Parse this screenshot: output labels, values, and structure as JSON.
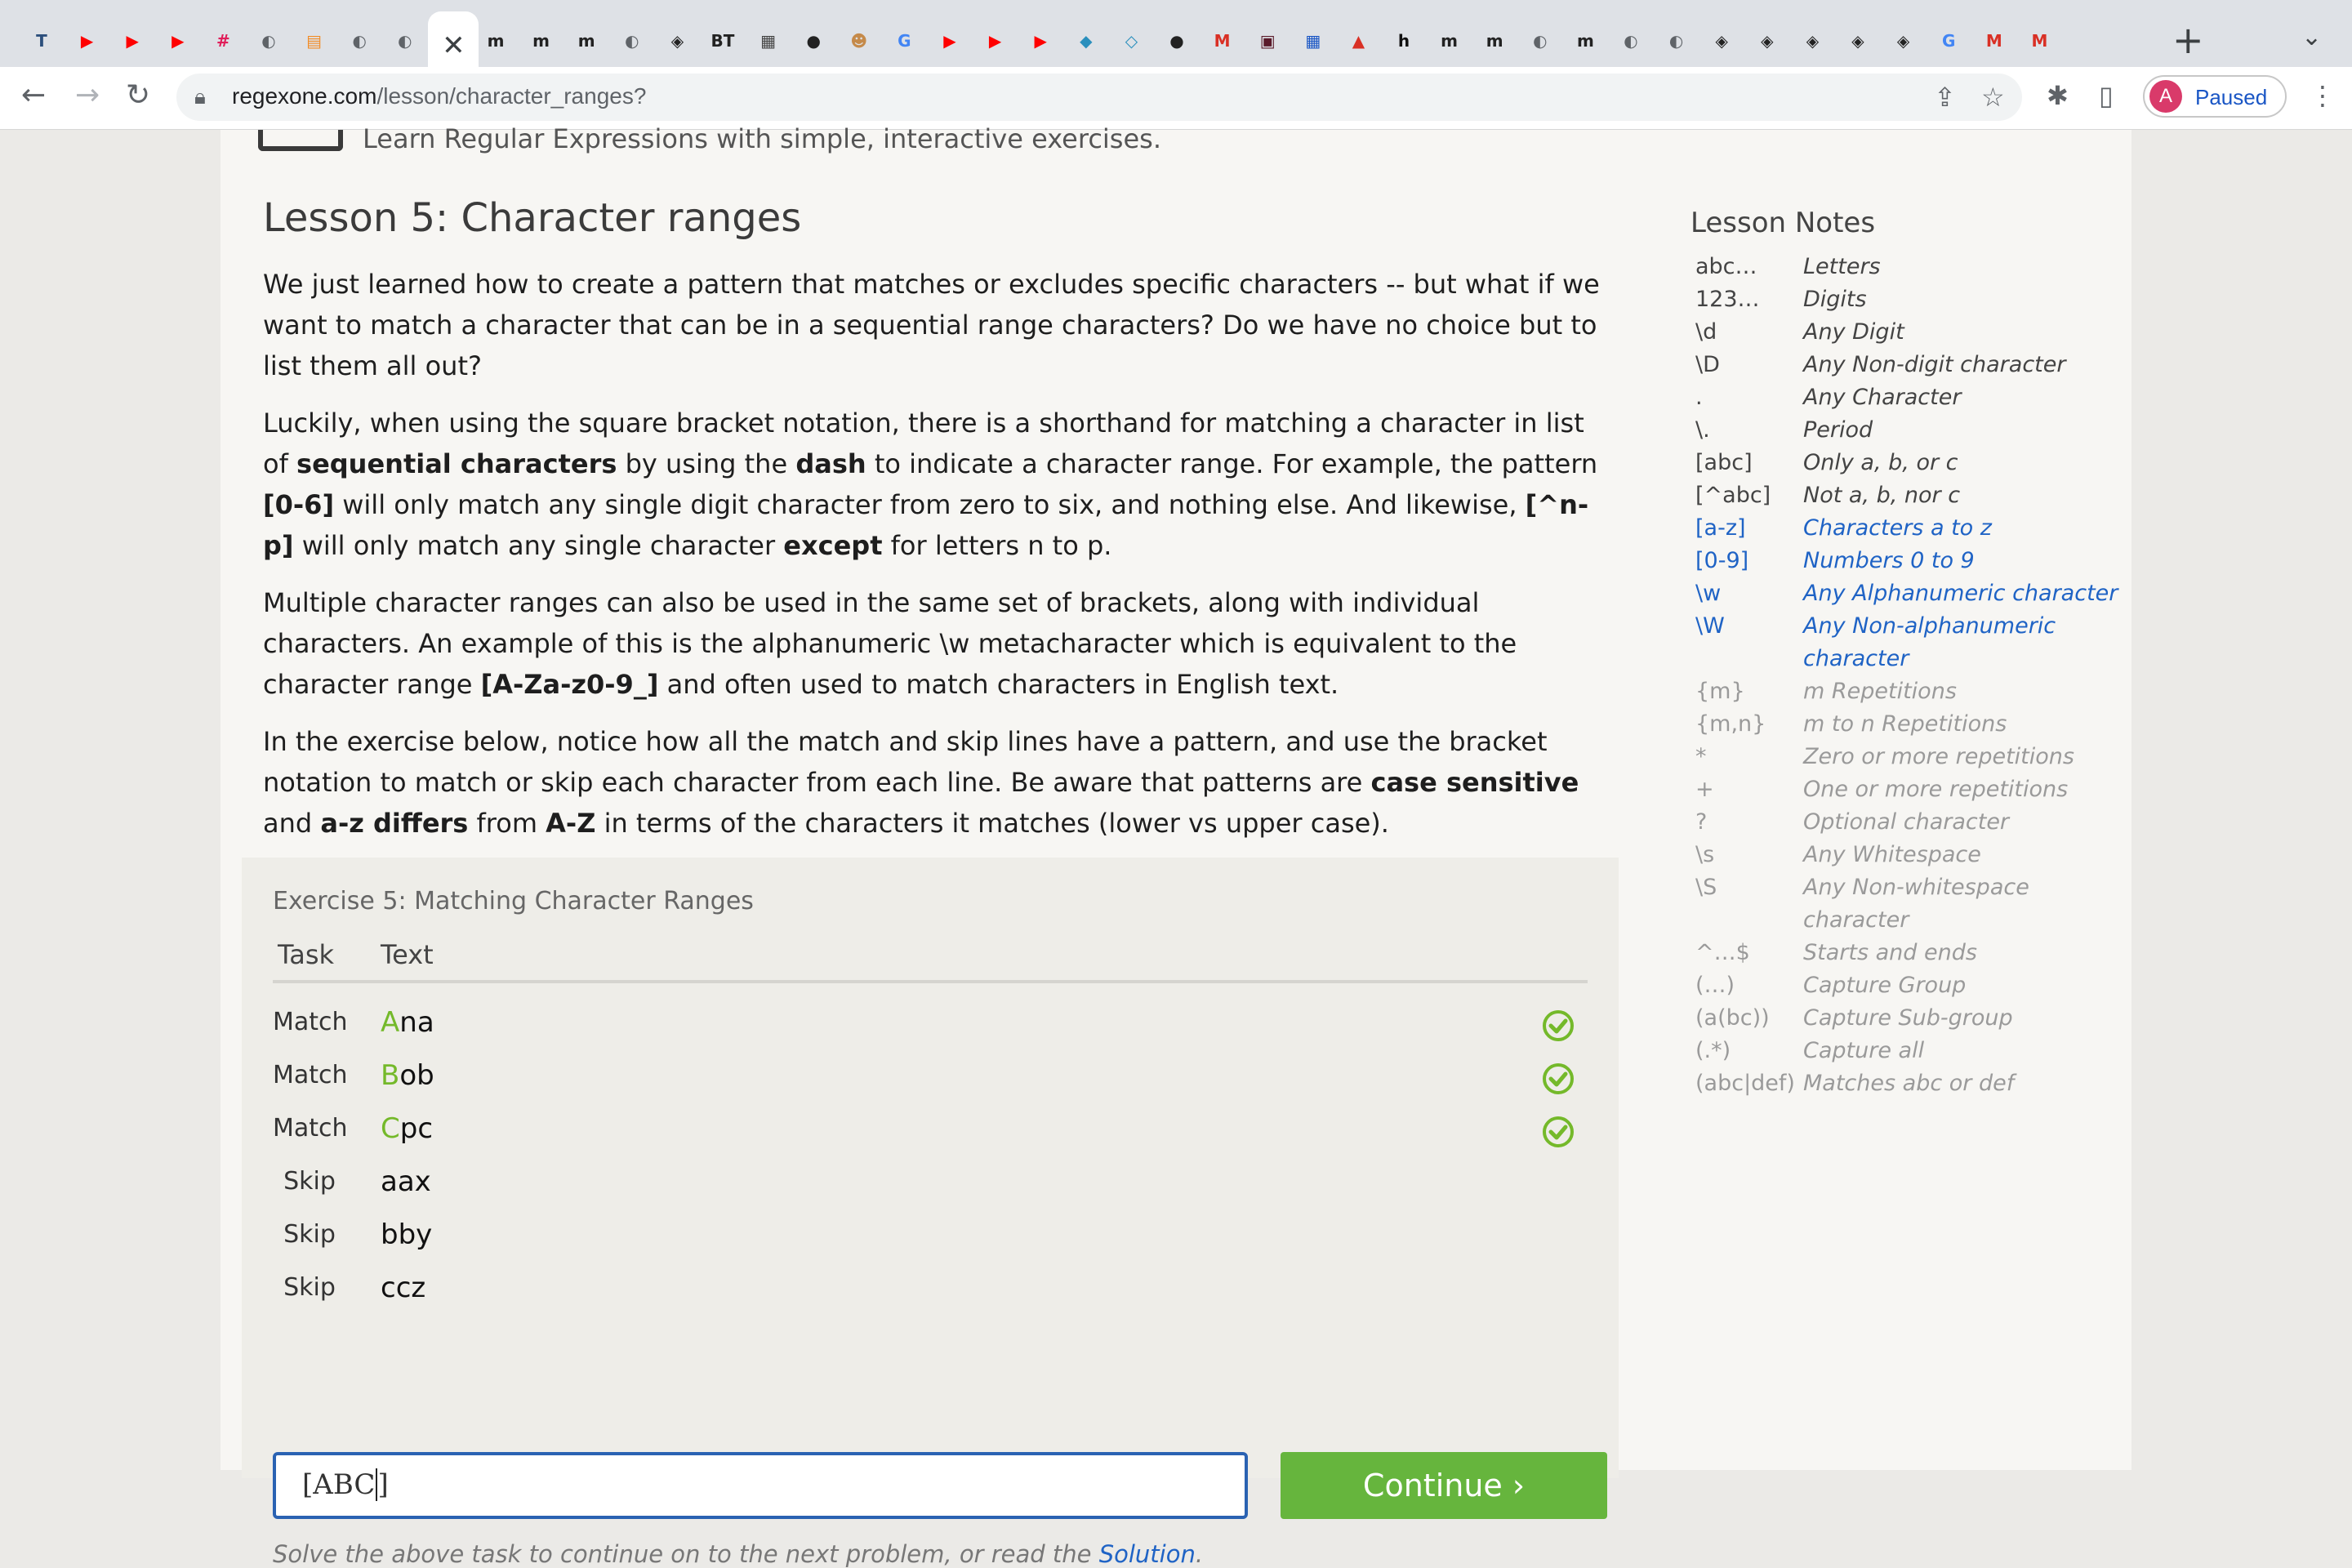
{
  "browser": {
    "tabs": [
      {
        "icon": "tumblr-t",
        "color": "#2c4f7c",
        "glyph": "T"
      },
      {
        "icon": "youtube",
        "color": "#ff0000",
        "glyph": "▶"
      },
      {
        "icon": "youtube",
        "color": "#ff0000",
        "glyph": "▶"
      },
      {
        "icon": "youtube",
        "color": "#ff0000",
        "glyph": "▶"
      },
      {
        "icon": "slack",
        "color": "#e01e5a",
        "glyph": "#"
      },
      {
        "icon": "globe",
        "color": "#5f6368",
        "glyph": "◐"
      },
      {
        "icon": "calendar",
        "color": "#f28b24",
        "glyph": "▤"
      },
      {
        "icon": "globe",
        "color": "#5f6368",
        "glyph": "◐"
      },
      {
        "icon": "globe",
        "color": "#5f6368",
        "glyph": "◐"
      },
      {
        "icon": "active-close",
        "color": "#3c4043",
        "glyph": "✕"
      },
      {
        "icon": "medium",
        "color": "#222",
        "glyph": "m"
      },
      {
        "icon": "medium",
        "color": "#222",
        "glyph": "m"
      },
      {
        "icon": "medium",
        "color": "#222",
        "glyph": "m"
      },
      {
        "icon": "globe",
        "color": "#5f6368",
        "glyph": "◐"
      },
      {
        "icon": "codepen",
        "color": "#222",
        "glyph": "◈"
      },
      {
        "icon": "bt",
        "color": "#222",
        "glyph": "BT"
      },
      {
        "icon": "pug",
        "color": "#444",
        "glyph": "▦"
      },
      {
        "icon": "github",
        "color": "#222",
        "glyph": "●"
      },
      {
        "icon": "person",
        "color": "#c58a4a",
        "glyph": "☻"
      },
      {
        "icon": "google",
        "color": "#4285f4",
        "glyph": "G"
      },
      {
        "icon": "youtube",
        "color": "#ff0000",
        "glyph": "▶"
      },
      {
        "icon": "youtube",
        "color": "#ff0000",
        "glyph": "▶"
      },
      {
        "icon": "youtube",
        "color": "#ff0000",
        "glyph": "▶"
      },
      {
        "icon": "diamond",
        "color": "#2a8fbd",
        "glyph": "◆"
      },
      {
        "icon": "diamond",
        "color": "#2a8fbd",
        "glyph": "◇"
      },
      {
        "icon": "github",
        "color": "#222",
        "glyph": "●"
      },
      {
        "icon": "gmail",
        "color": "#d93025",
        "glyph": "M"
      },
      {
        "icon": "dark-app",
        "color": "#5a1a2a",
        "glyph": "▣"
      },
      {
        "icon": "grid",
        "color": "#1a56c5",
        "glyph": "▦"
      },
      {
        "icon": "pdf",
        "color": "#d93025",
        "glyph": "▲"
      },
      {
        "icon": "h-app",
        "color": "#111",
        "glyph": "h"
      },
      {
        "icon": "medium",
        "color": "#222",
        "glyph": "m"
      },
      {
        "icon": "medium",
        "color": "#222",
        "glyph": "m"
      },
      {
        "icon": "globe",
        "color": "#5f6368",
        "glyph": "◐"
      },
      {
        "icon": "medium",
        "color": "#222",
        "glyph": "m"
      },
      {
        "icon": "globe",
        "color": "#5f6368",
        "glyph": "◐"
      },
      {
        "icon": "globe",
        "color": "#5f6368",
        "glyph": "◐"
      },
      {
        "icon": "codepen",
        "color": "#222",
        "glyph": "◈"
      },
      {
        "icon": "codepen",
        "color": "#222",
        "glyph": "◈"
      },
      {
        "icon": "codepen",
        "color": "#222",
        "glyph": "◈"
      },
      {
        "icon": "codepen",
        "color": "#222",
        "glyph": "◈"
      },
      {
        "icon": "codepen",
        "color": "#222",
        "glyph": "◈"
      },
      {
        "icon": "google",
        "color": "#4285f4",
        "glyph": "G"
      },
      {
        "icon": "gmail",
        "color": "#d93025",
        "glyph": "M"
      },
      {
        "icon": "gmail",
        "color": "#d93025",
        "glyph": "M"
      }
    ],
    "new_tab": "+",
    "tab_menu": "⌄",
    "url_host": "regexone.com",
    "url_path": "/lesson/character_ranges?",
    "profile_initial": "A",
    "profile_status": "Paused"
  },
  "site": {
    "tagline": "Learn Regular Expressions with simple, interactive exercises."
  },
  "lesson": {
    "title": "Lesson 5: Character ranges",
    "p1": "We just learned how to create a pattern that matches or excludes specific characters -- but what if we want to match a character that can be in a sequential range characters? Do we have no choice but to list them all out?",
    "p2": [
      "Luckily, when using the square bracket notation, there is a shorthand for matching a character in list of ",
      "sequential characters",
      " by using the ",
      "dash",
      " to indicate a character range. For example, the pattern ",
      "[0-6]",
      " will only match any single digit character from zero to six, and nothing else. And likewise, ",
      "[^n-p]",
      " will only match any single character ",
      "except",
      " for letters n to p."
    ],
    "p3": [
      "Multiple character ranges can also be used in the same set of brackets, along with individual characters. An example of this is the alphanumeric \\w metacharacter which is equivalent to the character range ",
      "[A-Za-z0-9_]",
      " and often used to match characters in English text."
    ],
    "p4": [
      "In the exercise below, notice how all the match and skip lines have a pattern, and use the bracket notation to match or skip each character from each line. Be aware that patterns are ",
      "case sensitive",
      " and ",
      "a-z differs",
      " from ",
      "A-Z",
      " in terms of the characters it matches (lower vs upper case)."
    ]
  },
  "exercise": {
    "title": "Exercise 5: Matching Character Ranges",
    "col_task": "Task",
    "col_text": "Text",
    "rows": [
      {
        "task": "Match",
        "highlight": "A",
        "rest": "na",
        "passed": true
      },
      {
        "task": "Match",
        "highlight": "B",
        "rest": "ob",
        "passed": true
      },
      {
        "task": "Match",
        "highlight": "C",
        "rest": "pc",
        "passed": true
      },
      {
        "task": "Skip",
        "highlight": "",
        "rest": "aax",
        "passed": false
      },
      {
        "task": "Skip",
        "highlight": "",
        "rest": "bby",
        "passed": false
      },
      {
        "task": "Skip",
        "highlight": "",
        "rest": "ccz",
        "passed": false
      }
    ],
    "input_value": "[ABC]",
    "continue_label": "Continue ›",
    "hint_text": "Solve the above task to continue on to the next problem, or read the ",
    "hint_link": "Solution",
    "hint_end": "."
  },
  "notes": {
    "title": "Lesson Notes",
    "items": [
      {
        "k": "abc…",
        "v": "Letters",
        "style": "dark"
      },
      {
        "k": "123…",
        "v": "Digits",
        "style": "dark"
      },
      {
        "k": "\\d",
        "v": "Any Digit",
        "style": "dark"
      },
      {
        "k": "\\D",
        "v": "Any Non-digit character",
        "style": "dark"
      },
      {
        "k": ".",
        "v": "Any Character",
        "style": "dark"
      },
      {
        "k": "\\.",
        "v": "Period",
        "style": "dark"
      },
      {
        "k": "[abc]",
        "v": "Only a, b, or c",
        "style": "dark"
      },
      {
        "k": "[^abc]",
        "v": "Not a, b, nor c",
        "style": "dark"
      },
      {
        "k": "[a-z]",
        "v": "Characters a to z",
        "style": "blue"
      },
      {
        "k": "[0-9]",
        "v": "Numbers 0 to 9",
        "style": "blue"
      },
      {
        "k": "\\w",
        "v": "Any Alphanumeric character",
        "style": "blue"
      },
      {
        "k": "\\W",
        "v": "Any Non-alphanumeric character",
        "style": "blue"
      },
      {
        "k": "{m}",
        "v": "m Repetitions",
        "style": "gray"
      },
      {
        "k": "{m,n}",
        "v": "m to n Repetitions",
        "style": "gray"
      },
      {
        "k": "*",
        "v": "Zero or more repetitions",
        "style": "gray"
      },
      {
        "k": "+",
        "v": "One or more repetitions",
        "style": "gray"
      },
      {
        "k": "?",
        "v": "Optional character",
        "style": "gray"
      },
      {
        "k": "\\s",
        "v": "Any Whitespace",
        "style": "gray"
      },
      {
        "k": "\\S",
        "v": "Any Non-whitespace character",
        "style": "gray"
      },
      {
        "k": "^…$",
        "v": "Starts and ends",
        "style": "gray"
      },
      {
        "k": "(…)",
        "v": "Capture Group",
        "style": "gray"
      },
      {
        "k": "(a(bc))",
        "v": "Capture Sub-group",
        "style": "gray"
      },
      {
        "k": "(.*)",
        "v": "Capture all",
        "style": "gray"
      },
      {
        "k": "(abc|def)",
        "v": "Matches abc or def",
        "style": "gray"
      }
    ]
  },
  "colors": {
    "accent_green": "#66b53d",
    "check_green": "#74b92a",
    "link_blue": "#1f63c5"
  }
}
